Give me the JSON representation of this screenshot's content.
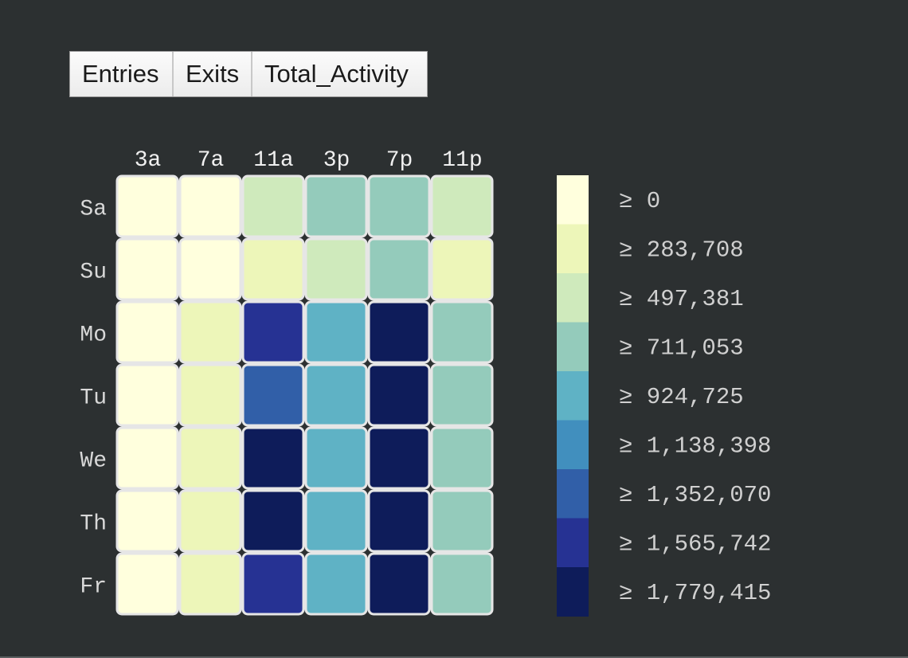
{
  "toolbar": {
    "buttons": [
      "Entries",
      "Exits",
      "Total_Activity"
    ]
  },
  "chart_data": {
    "type": "heatmap",
    "x_labels": [
      "3a",
      "7a",
      "11a",
      "3p",
      "7p",
      "11p"
    ],
    "y_labels": [
      "Sa",
      "Su",
      "Mo",
      "Tu",
      "We",
      "Th",
      "Fr"
    ],
    "bin_index": [
      [
        0,
        0,
        2,
        3,
        3,
        2
      ],
      [
        0,
        0,
        1,
        2,
        3,
        1
      ],
      [
        0,
        1,
        7,
        4,
        8,
        3
      ],
      [
        0,
        1,
        6,
        4,
        8,
        3
      ],
      [
        0,
        1,
        8,
        4,
        8,
        3
      ],
      [
        0,
        1,
        8,
        4,
        8,
        3
      ],
      [
        0,
        1,
        7,
        4,
        8,
        3
      ]
    ],
    "legend": {
      "thresholds": [
        "≥ 0",
        "≥ 283,708",
        "≥ 497,381",
        "≥ 711,053",
        "≥ 924,725",
        "≥ 1,138,398",
        "≥ 1,352,070",
        "≥ 1,565,742",
        "≥ 1,779,415"
      ],
      "colors": [
        "#ffffdd",
        "#edf6b9",
        "#cfeabc",
        "#94cbbb",
        "#5fb2c5",
        "#418fbe",
        "#315fa8",
        "#263293",
        "#0e1c5a"
      ]
    }
  }
}
